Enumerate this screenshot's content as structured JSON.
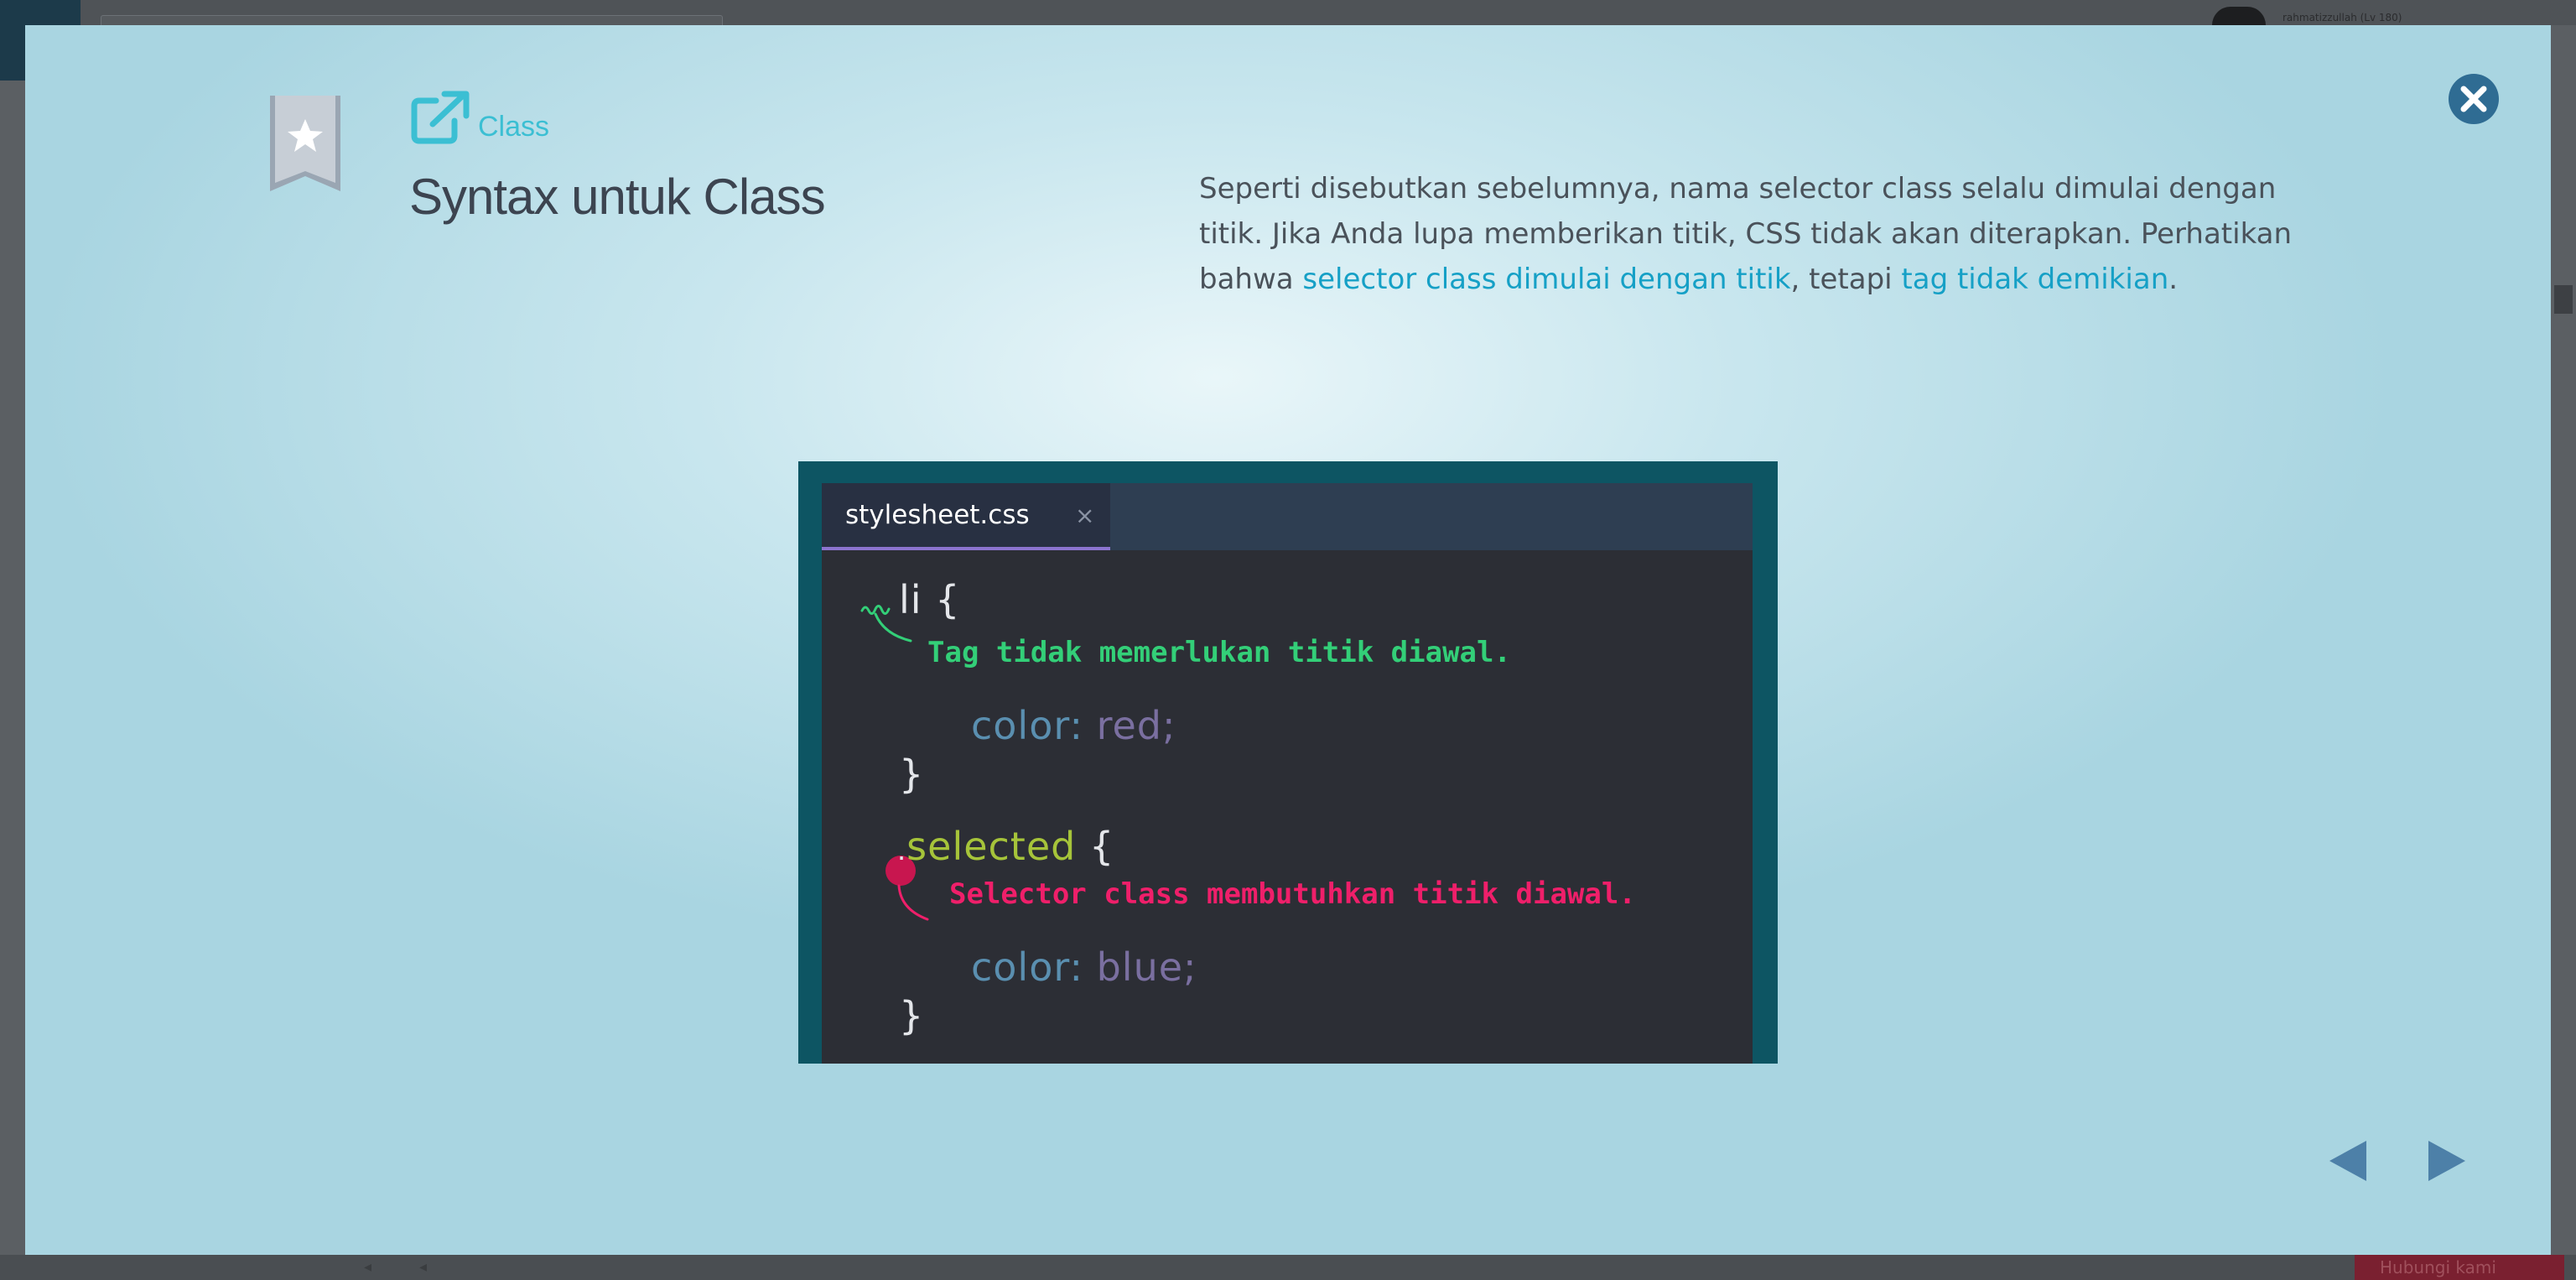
{
  "background": {
    "user_name": "rahmatizzullah (Lv 180)",
    "bottom_button_label": "Hubungi kami"
  },
  "modal": {
    "breadcrumb": "Class",
    "title": "Syntax untuk Class",
    "description": {
      "part1": "Seperti disebutkan sebelumnya, nama selector class selalu dimulai dengan titik. Jika Anda lupa memberikan titik, CSS tidak akan diterapkan. Perhatikan bahwa ",
      "link1": "selector class dimulai dengan titik",
      "part2": ", tetapi ",
      "link2": "tag tidak demikian",
      "part3": "."
    },
    "icons": {
      "bookmark": "bookmark-star-icon",
      "link": "external-link-icon",
      "close": "close-icon",
      "prev": "triangle-left-icon",
      "next": "triangle-right-icon"
    },
    "colors": {
      "accent": "#3bbfd3",
      "link": "#16a0c6",
      "title": "#3c4450"
    }
  },
  "illustration": {
    "tab_name": "stylesheet.css",
    "tab_close": "×",
    "code": {
      "line1_selector": "li",
      "line1_brace": " {",
      "line2_prop": "color",
      "line2_colon": ": ",
      "line2_value": "red",
      "line2_semi": ";",
      "line3_brace": "}",
      "line4_dot": ".",
      "line4_selector": "selected",
      "line4_brace": " {",
      "line5_prop": "color",
      "line5_colon": ": ",
      "line5_value": "blue",
      "line5_semi": ";",
      "line6_brace": "}"
    },
    "note_tag": "Tag tidak memerlukan titik diawal.",
    "note_class": "Selector class membutuhkan titik diawal.",
    "colors": {
      "note_green": "#33cf78",
      "note_pink": "#ef1f6a",
      "selector": "#a6c43a",
      "property": "#5a8fb0",
      "value": "#7a6fa0"
    }
  }
}
